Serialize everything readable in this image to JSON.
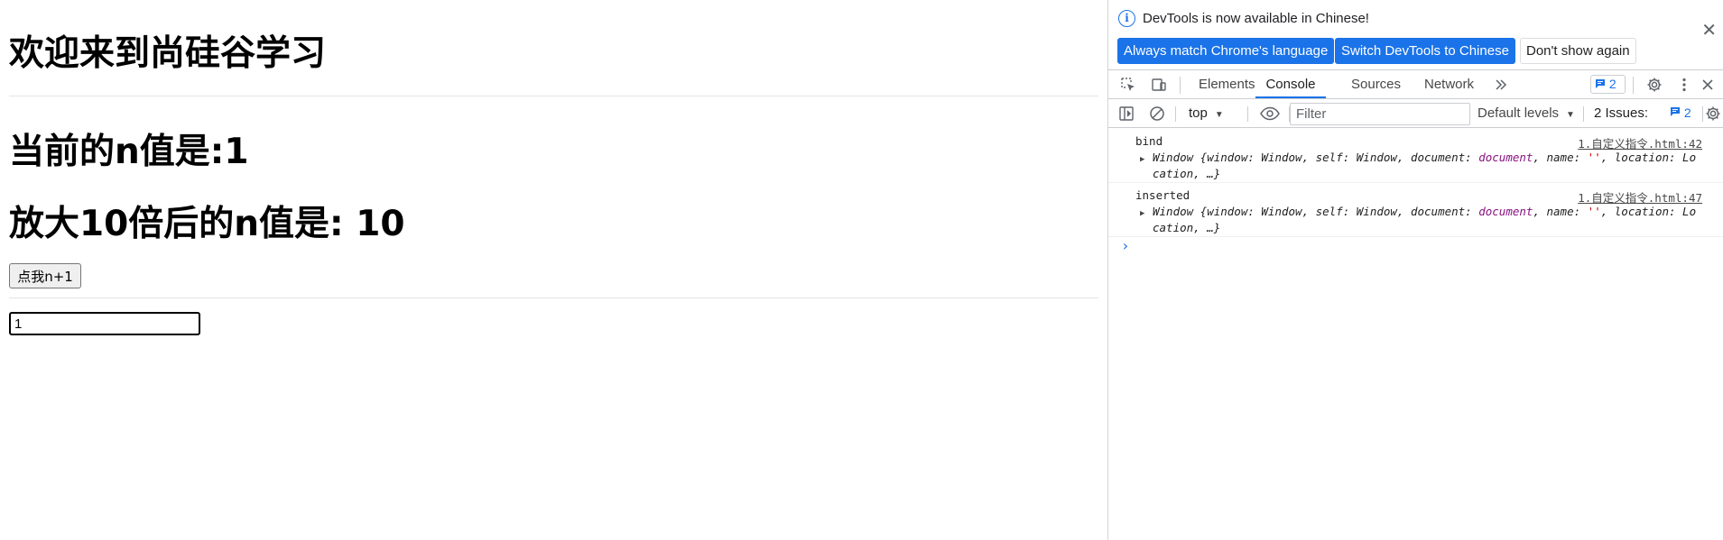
{
  "page": {
    "title": "欢迎来到尚硅谷学习",
    "n_line": "当前的n值是:1",
    "big_line": "放大10倍后的n值是: 10",
    "button_label": "点我n+1",
    "input_value": "1"
  },
  "devtools": {
    "infobar": {
      "message": "DevTools is now available in Chinese!",
      "always_match": "Always match Chrome's language",
      "switch": "Switch DevTools to Chinese",
      "dont_show": "Don't show again"
    },
    "tabs": [
      "Elements",
      "Console",
      "Sources",
      "Network"
    ],
    "active_tab": "Console",
    "message_count": "2",
    "toolbar": {
      "context": "top",
      "filter_placeholder": "Filter",
      "levels": "Default levels",
      "issues_label": "2 Issues:",
      "issues_count": "2"
    },
    "logs": [
      {
        "label": "bind",
        "source": "1.自定义指令.html:42",
        "object_prefix": "Window {window: Window, self: Window, document: ",
        "object_document": "document",
        "object_name_key": ", name: ",
        "object_name_val": "''",
        "object_suffix": ", location: Location, …}"
      },
      {
        "label": "inserted",
        "source": "1.自定义指令.html:47",
        "object_prefix": "Window {window: Window, self: Window, document: ",
        "object_document": "document",
        "object_name_key": ", name: ",
        "object_name_val": "''",
        "object_suffix": ", location: Location, …}"
      }
    ],
    "prompt": "›",
    "colors": {
      "accent": "#1a73e8",
      "string": "#c80000",
      "keyword": "#881280"
    }
  }
}
